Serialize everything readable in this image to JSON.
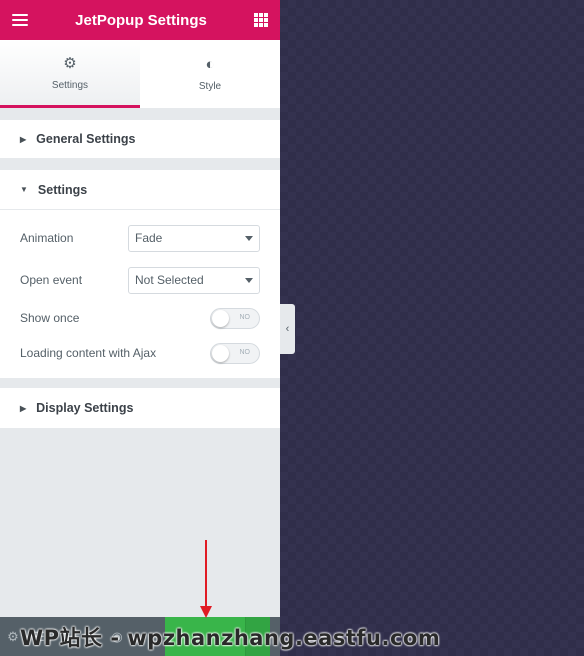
{
  "header": {
    "title": "JetPopup Settings"
  },
  "tabs": [
    {
      "label": "Settings",
      "icon": "gear-icon"
    },
    {
      "label": "Style",
      "icon": "half-circle-icon"
    }
  ],
  "sections": {
    "general": "General Settings",
    "settings": "Settings",
    "display": "Display Settings"
  },
  "fields": {
    "animation": {
      "label": "Animation",
      "value": "Fade"
    },
    "open_event": {
      "label": "Open event",
      "value": "Not Selected"
    },
    "show_once": {
      "label": "Show once",
      "state": "NO"
    },
    "ajax": {
      "label": "Loading content with Ajax",
      "state": "NO"
    }
  },
  "watermark": "WP站长 - wpzhanzhang.eastfu.com",
  "colors": {
    "brand": "#d5135f",
    "publish": "#39b54a",
    "annotation": "#e01b24"
  }
}
